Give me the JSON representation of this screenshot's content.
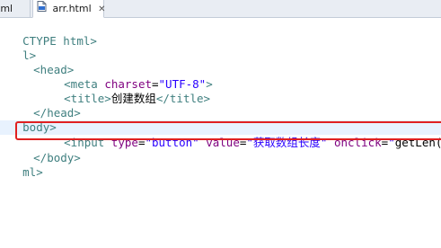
{
  "tabs": [
    {
      "label": "tml"
    },
    {
      "label": "arr.html",
      "close": "✕"
    }
  ],
  "code": {
    "line1": {
      "a": "CTYPE html>"
    },
    "line2": {
      "a": "l>"
    },
    "line3": {
      "a": "<head>"
    },
    "line4": {
      "a": "<meta ",
      "b": "charset",
      "c": "=",
      "d": "\"UTF-8\"",
      "e": ">"
    },
    "line5": {
      "a": "<title>",
      "b": "创建数组",
      "c": "</title>"
    },
    "line6": {
      "a": "</head>"
    },
    "line7": {
      "a": "body>"
    },
    "line8": {
      "a": "<input ",
      "b": "type",
      "c": "=",
      "d": "\"button\"",
      "e": " value",
      "f": "=",
      "g": "\"获取数组长度\"",
      "h": " onclick",
      "i": "=",
      "j": "\"",
      "k": "getLen()",
      "l": "\"",
      "m": " />"
    },
    "line9": {
      "a": "</body>"
    },
    "line10": {
      "a": "ml>"
    }
  }
}
